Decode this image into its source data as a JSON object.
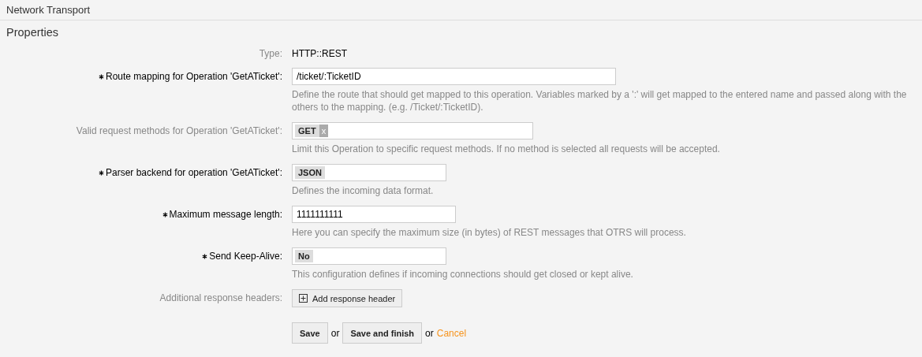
{
  "header": {
    "title": "Network Transport"
  },
  "section": {
    "title": "Properties"
  },
  "fields": [
    {
      "kind": "static",
      "label": "Type:",
      "required": false,
      "value": "HTTP::REST"
    },
    {
      "kind": "text",
      "label": "Route mapping for Operation 'GetATicket':",
      "required": true,
      "value": "/ticket/:TicketID",
      "help": "Define the route that should get mapped to this operation. Variables marked by a ':' will get mapped to the entered name and passed along with the others to the mapping. (e.g. /Ticket/:TicketID)."
    },
    {
      "kind": "tags",
      "label": "Valid request methods for Operation 'GetATicket':",
      "required": false,
      "tags": [
        {
          "text": "GET",
          "remove": "x"
        }
      ],
      "help": "Limit this Operation to specific request methods. If no method is selected all requests will be accepted."
    },
    {
      "kind": "select",
      "label": "Parser backend for operation 'GetATicket':",
      "required": true,
      "value": "JSON",
      "help": "Defines the incoming data format."
    },
    {
      "kind": "text",
      "label": "Maximum message length:",
      "required": true,
      "value": "1111111111",
      "help": "Here you can specify the maximum size (in bytes) of REST messages that OTRS will process."
    },
    {
      "kind": "select",
      "label": "Send Keep-Alive:",
      "required": true,
      "value": "No",
      "help": "This configuration defines if incoming connections should get closed or kept alive."
    },
    {
      "kind": "button",
      "label": "Additional response headers:",
      "required": false,
      "value": "Add response header"
    }
  ],
  "actions": {
    "save": "Save",
    "or1": "or",
    "save_finish": "Save and finish",
    "or2": "or",
    "cancel": "Cancel"
  }
}
